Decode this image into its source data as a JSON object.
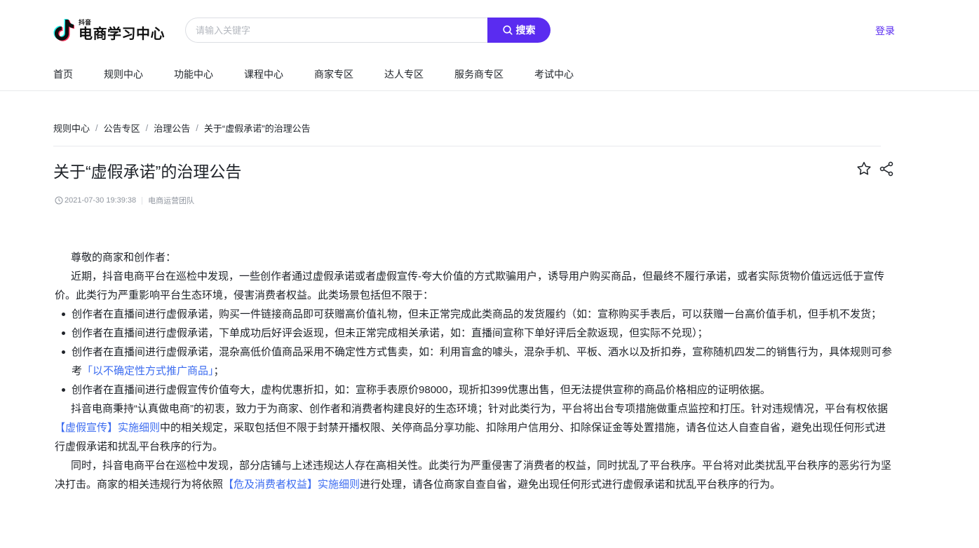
{
  "header": {
    "logo_small": "抖音",
    "logo_big": "电商学习中心",
    "search_placeholder": "请输入关键字",
    "search_button": "搜索",
    "login": "登录"
  },
  "nav": {
    "items": [
      "首页",
      "规则中心",
      "功能中心",
      "课程中心",
      "商家专区",
      "达人专区",
      "服务商专区",
      "考试中心"
    ]
  },
  "breadcrumb": {
    "items": [
      "规则中心",
      "公告专区",
      "治理公告",
      "关于“虚假承诺”的治理公告"
    ],
    "separator": "/"
  },
  "article": {
    "title": "关于“虚假承诺”的治理公告",
    "datetime": "2021-07-30 19:39:38",
    "author": "电商运营团队",
    "greeting": "尊敬的商家和创作者：",
    "intro": "近期，抖音电商平台在巡检中发现，一些创作者通过虚假承诺或者虚假宣传-夸大价值的方式欺骗用户，诱导用户购买商品，但最终不履行承诺，或者实际货物价值远远低于宣传价。此类行为严重影响平台生态环境，侵害消费者权益。此类场景包括但不限于：",
    "bullet1": "创作者在直播间进行虚假承诺，购买一件链接商品即可获赠高价值礼物，但未正常完成此类商品的发货履约（如：宣称购买手表后，可以获赠一台高价值手机，但手机不发货；",
    "bullet2": "创作者在直播间进行虚假承诺，下单成功后好评会返现，但未正常完成相关承诺，如：直播间宣称下单好评后全款返现，但实际不兑现）；",
    "bullet3_before": "创作者在直播间进行虚假承诺，混杂高低价值商品采用不确定性方式售卖，如：利用盲盒的噱头，混杂手机、平板、酒水以及折扣券，宣称随机四发二的销售行为，具体规则可参考",
    "bullet3_link": "「以不确定性方式推广商品」",
    "bullet3_after": "；",
    "bullet4": "创作者在直播间进行虚假宣传价值夸大，虚构优惠折扣，如：宣称手表原价98000，现折扣399优惠出售，但无法提供宣称的商品价格相应的证明依据。",
    "para3_before": "抖音电商秉持“认真做电商”的初衷，致力于为商家、创作者和消费者构建良好的生态环境；针对此类行为，平台将出台专项措施做重点监控和打压。针对违规情况，平台有权依据",
    "para3_link": "【虚假宣传】实施细则",
    "para3_after": "中的相关规定，采取包括但不限于封禁开播权限、关停商品分享功能、扣除用户信用分、扣除保证金等处置措施，请各位达人自查自省，避免出现任何形式进行虚假承诺和扰乱平台秩序的行为。",
    "para4_before": "同时，抖音电商平台在巡检中发现，部分店铺与上述违规达人存在高相关性。此类行为严重侵害了消费者的权益，同时扰乱了平台秩序。平台将对此类扰乱平台秩序的恶劣行为坚决打击。商家的相关违规行为将依照",
    "para4_link": "【危及消费者权益】实施细则",
    "para4_after": "进行处理，请各位商家自查自省，避免出现任何形式进行虚假承诺和扰乱平台秩序的行为。"
  },
  "colors": {
    "accent": "#5a2cf0",
    "link": "#3c6cf0",
    "text": "#1f2329",
    "muted": "#8f959e"
  },
  "icons": {
    "logo": "tiktok-note-icon",
    "search": "search-icon",
    "favorite": "star-icon",
    "share": "share-icon",
    "clock": "clock-icon"
  }
}
